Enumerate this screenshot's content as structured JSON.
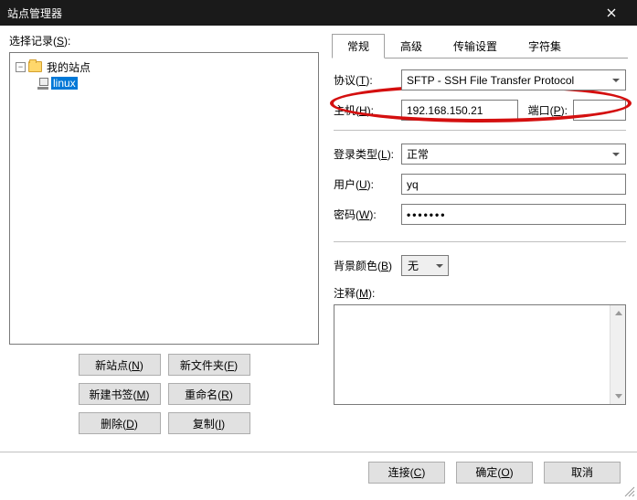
{
  "title": "站点管理器",
  "left": {
    "label": "选择记录(S):",
    "tree": {
      "root": "我的站点",
      "child": "linux"
    },
    "buttons": {
      "new_site": "新站点(N)",
      "new_folder": "新文件夹(F)",
      "new_bookmark": "新建书签(M)",
      "rename": "重命名(R)",
      "delete": "删除(D)",
      "copy": "复制(I)"
    }
  },
  "tabs": {
    "general": "常规",
    "advanced": "高级",
    "transfer": "传输设置",
    "charset": "字符集"
  },
  "form": {
    "protocol_label": "协议(T):",
    "protocol_value": "SFTP - SSH File Transfer Protocol",
    "host_label": "主机(H):",
    "host_value": "192.168.150.21",
    "port_label": "端口(P):",
    "port_value": "",
    "logon_label": "登录类型(L):",
    "logon_value": "正常",
    "user_label": "用户(U):",
    "user_value": "yq",
    "password_label": "密码(W):",
    "password_value": "•••••••",
    "bgcolor_label": "背景颜色(B)",
    "bgcolor_value": "无",
    "comment_label": "注释(M):"
  },
  "bottom": {
    "connect": "连接(C)",
    "ok": "确定(O)",
    "cancel": "取消"
  }
}
